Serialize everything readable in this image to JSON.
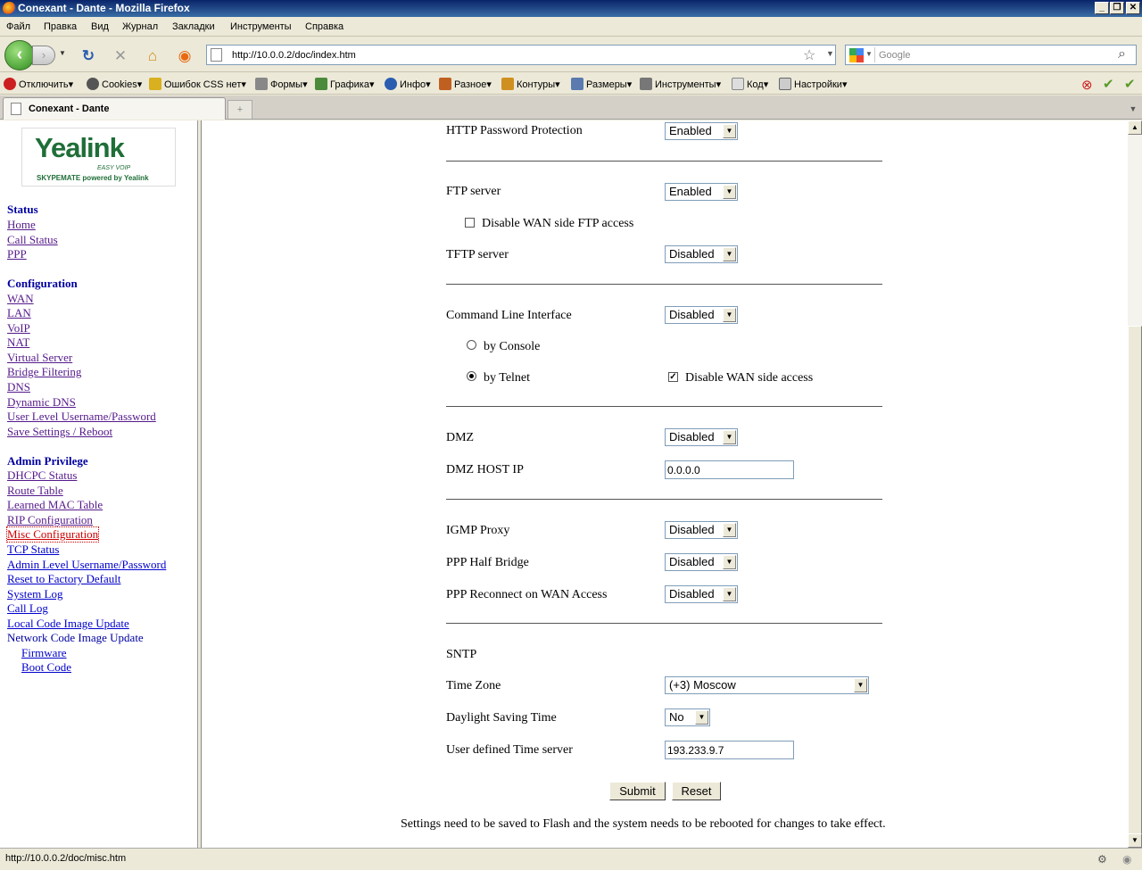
{
  "window": {
    "title": "Conexant - Dante - Mozilla Firefox"
  },
  "menu": [
    "Файл",
    "Правка",
    "Вид",
    "Журнал",
    "Закладки",
    "Инструменты",
    "Справка"
  ],
  "nav": {
    "url": "http://10.0.0.2/doc/index.htm",
    "search_placeholder": "Google"
  },
  "devbar": {
    "disable": "Отключить",
    "cookies": "Cookies",
    "css": "Ошибок CSS нет",
    "forms": "Формы",
    "images": "Графика",
    "info": "Инфо",
    "misc": "Разное",
    "outline": "Контуры",
    "resize": "Размеры",
    "tools": "Инструменты",
    "source": "Код",
    "options": "Настройки"
  },
  "tab": {
    "label": "Conexant - Dante"
  },
  "logo": {
    "brand": "Yealink",
    "tag": "EASY VOIP",
    "sub": "SKYPEMATE powered by Yealink"
  },
  "sidebar": {
    "status_head": "Status",
    "status_links": [
      "Home",
      "Call Status",
      "PPP"
    ],
    "config_head": "Configuration",
    "config_links": [
      "WAN",
      "LAN",
      "VoIP",
      "NAT",
      "Virtual Server",
      "Bridge Filtering",
      "DNS",
      "Dynamic DNS",
      "User Level Username/Password",
      "Save Settings / Reboot"
    ],
    "admin_head": "Admin Privilege",
    "admin_links": [
      "DHCPC Status",
      "Route Table",
      "Learned MAC Table",
      "RIP Configuration",
      "Misc Configuration",
      "TCP Status",
      "Admin Level Username/Password",
      "Reset to Factory Default",
      "System Log",
      "Call Log",
      "Local Code Image Update",
      "Network Code Image Update"
    ],
    "sub_links": [
      "Firmware",
      "Boot Code"
    ]
  },
  "form": {
    "http_label": "HTTP Password Protection",
    "http_value": "Enabled",
    "ftp_label": "FTP server",
    "ftp_value": "Enabled",
    "ftp_wan_label": "Disable WAN side FTP access",
    "tftp_label": "TFTP server",
    "tftp_value": "Disabled",
    "cli_label": "Command Line Interface",
    "cli_value": "Disabled",
    "console_label": "by Console",
    "telnet_label": "by Telnet",
    "telnet_wan_label": "Disable WAN side access",
    "dmz_label": "DMZ",
    "dmz_value": "Disabled",
    "dmz_host_label": "DMZ HOST IP",
    "dmz_host_value": "0.0.0.0",
    "igmp_label": "IGMP Proxy",
    "igmp_value": "Disabled",
    "ppp_half_label": "PPP Half Bridge",
    "ppp_half_value": "Disabled",
    "ppp_reconnect_label": "PPP Reconnect on WAN Access",
    "ppp_reconnect_value": "Disabled",
    "sntp_label": "SNTP",
    "tz_label": "Time Zone",
    "tz_value": "(+3) Moscow",
    "dst_label": "Daylight Saving Time",
    "dst_value": "No",
    "time_server_label": "User defined Time server",
    "time_server_value": "193.233.9.7",
    "submit_label": "Submit",
    "reset_label": "Reset",
    "note": "Settings need to be saved to Flash and the system needs to be rebooted for changes to take effect."
  },
  "status": {
    "text": "http://10.0.0.2/doc/misc.htm"
  }
}
